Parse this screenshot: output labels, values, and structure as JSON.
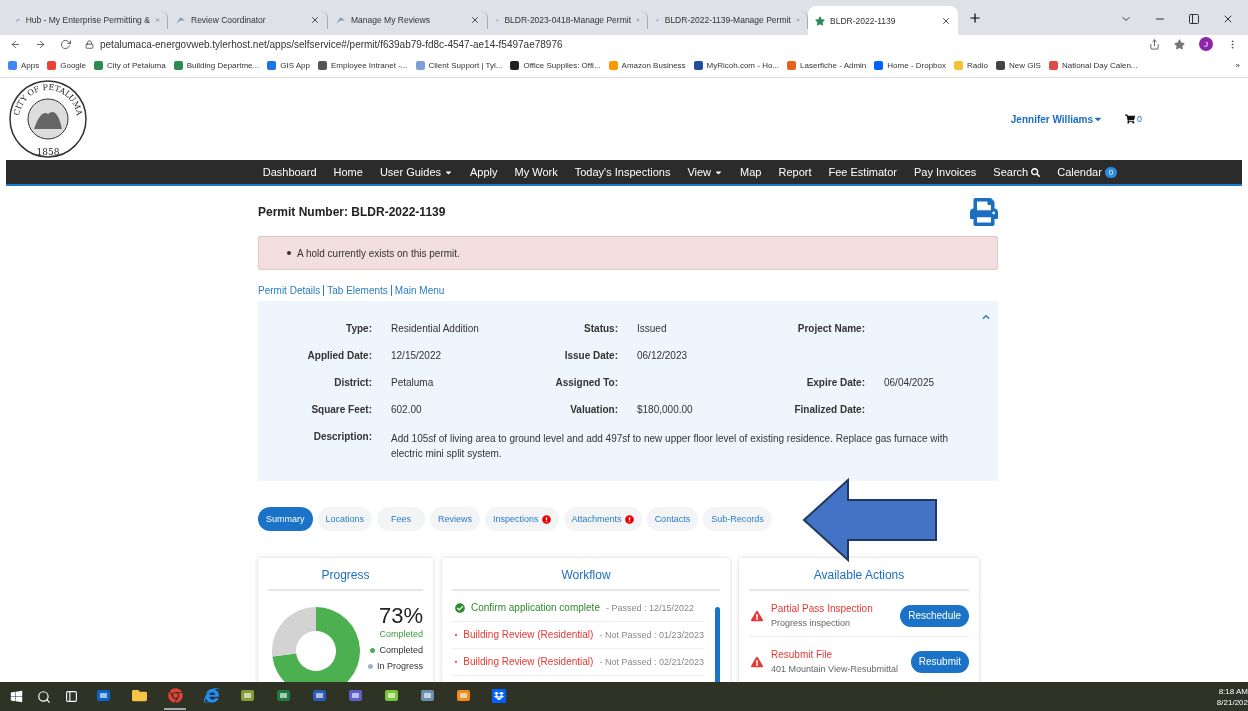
{
  "browser": {
    "tabs": [
      {
        "title": "Hub - My Enterprise Permitting &",
        "kind": "hub",
        "selected": false
      },
      {
        "title": "Review Coordinator",
        "kind": "hub",
        "selected": false
      },
      {
        "title": "Manage My Reviews",
        "kind": "hub",
        "selected": false
      },
      {
        "title": "BLDR-2023-0418-Manage Permit",
        "kind": "hub",
        "selected": false
      },
      {
        "title": "BLDR-2022-1139-Manage Permit",
        "kind": "hub",
        "selected": false
      },
      {
        "title": "BLDR-2022-1139",
        "kind": "star",
        "selected": true
      }
    ],
    "url": "petalumaca-energovweb.tylerhost.net/apps/selfservice#/permit/f639ab79-fd8c-4547-ae14-f5497ae78976",
    "profile_initial": "J",
    "bookmarks": [
      {
        "label": "Apps",
        "color": "#4285f4"
      },
      {
        "label": "Google",
        "color": "#ea4335"
      },
      {
        "label": "City of Petaluma",
        "color": "#2e8b57"
      },
      {
        "label": "Building Departme...",
        "color": "#2e8b57"
      },
      {
        "label": "GIS App",
        "color": "#1a73e8"
      },
      {
        "label": "Employee Intranet -...",
        "color": "#555555"
      },
      {
        "label": "Client Support | Tyl...",
        "color": "#7aa0d6"
      },
      {
        "label": "Office Supplies: Offi...",
        "color": "#222222"
      },
      {
        "label": "Amazon Business",
        "color": "#ff9900"
      },
      {
        "label": "MyRicoh.com - Ho...",
        "color": "#1f4e9c"
      },
      {
        "label": "Laserfiche - Admin",
        "color": "#e8601c"
      },
      {
        "label": "Home - Dropbox",
        "color": "#0061fe"
      },
      {
        "label": "Radio",
        "color": "#f4c430"
      },
      {
        "label": "New GIS",
        "color": "#444444"
      },
      {
        "label": "National Day Calen...",
        "color": "#e04a4a"
      }
    ],
    "more": "»"
  },
  "header": {
    "seal": {
      "name": "CITY OF PETALUMA",
      "year": "1858"
    },
    "user": "Jennifer Williams",
    "cart_count": "0"
  },
  "nav": [
    {
      "label": "Dashboard",
      "kind": "link"
    },
    {
      "label": "Home",
      "kind": "link"
    },
    {
      "label": "User Guides",
      "kind": "dropdown"
    },
    {
      "label": "Apply",
      "kind": "link"
    },
    {
      "label": "My Work",
      "kind": "link"
    },
    {
      "label": "Today's Inspections",
      "kind": "link"
    },
    {
      "label": "View",
      "kind": "dropdown"
    },
    {
      "label": "Map",
      "kind": "link"
    },
    {
      "label": "Report",
      "kind": "link"
    },
    {
      "label": "Fee Estimator",
      "kind": "link"
    },
    {
      "label": "Pay Invoices",
      "kind": "link"
    },
    {
      "label": "Search",
      "kind": "search"
    },
    {
      "label": "Calendar",
      "kind": "badge",
      "badge": "0"
    }
  ],
  "permit": {
    "title": "Permit Number: BLDR-2022-1139",
    "alert": "A hold currently exists on this permit.",
    "links": [
      "Permit Details",
      "Tab Elements",
      "Main Menu"
    ],
    "details": [
      [
        {
          "label": "Type:",
          "value": "Residential Addition"
        },
        {
          "label": "Status:",
          "value": "Issued"
        },
        {
          "label": "Project Name:"
        }
      ],
      [
        {
          "label": "Applied Date:",
          "value": "12/15/2022"
        },
        {
          "label": "Issue Date:",
          "value": "06/12/2023"
        }
      ],
      [
        {
          "label": "District:",
          "value": "Petaluma"
        },
        {
          "label": "Assigned To:"
        },
        {
          "label": "Expire Date:",
          "value": "06/04/2025"
        }
      ],
      [
        {
          "label": "Square Feet:",
          "value": "602.00"
        },
        {
          "label": "Valuation:",
          "value": "$180,000.00"
        },
        {
          "label": "Finalized Date:"
        }
      ]
    ],
    "description": {
      "label": "Description:",
      "value": "Add 105sf of living area to ground level and add 497sf to new upper floor level of existing residence. Replace gas furnace with electric mini split system."
    }
  },
  "tabs": [
    {
      "label": "Summary",
      "selected": true,
      "alert": false
    },
    {
      "label": "Locations",
      "selected": false,
      "alert": false
    },
    {
      "label": "Fees",
      "selected": false,
      "alert": false
    },
    {
      "label": "Reviews",
      "selected": false,
      "alert": false
    },
    {
      "label": "Inspections",
      "selected": false,
      "alert": true
    },
    {
      "label": "Attachments",
      "selected": false,
      "alert": true
    },
    {
      "label": "Contacts",
      "selected": false,
      "alert": false
    },
    {
      "label": "Sub-Records",
      "selected": false,
      "alert": false
    }
  ],
  "progress": {
    "title": "Progress",
    "percent": "73%",
    "caption": "Completed",
    "chart_data": {
      "type": "donut",
      "categories": [
        "Completed",
        "In Progress"
      ],
      "values": [
        73,
        27
      ]
    }
  },
  "workflow": {
    "title": "Workflow",
    "steps": [
      {
        "name": "Confirm application complete",
        "result": "- Passed : 12/15/2022",
        "passed": true
      },
      {
        "name": "Building Review (Residential)",
        "result": "- Not Passed : 01/23/2023",
        "passed": false
      },
      {
        "name": "Building Review (Residential)",
        "result": "- Not Passed : 02/21/2023",
        "passed": false
      }
    ]
  },
  "actions": {
    "title": "Available Actions",
    "items": [
      {
        "name": "Partial Pass Inspection",
        "detail": "Progress inspection",
        "button": "Reschedule"
      },
      {
        "name": "Resubmit File",
        "detail": "401 Mountain View-Resubmittal",
        "button": "Resubmit"
      }
    ]
  },
  "taskbar": {
    "apps": [
      {
        "kind": "outlook",
        "active": false
      },
      {
        "kind": "folder",
        "active": false
      },
      {
        "kind": "chrome",
        "active": true
      },
      {
        "kind": "ie",
        "active": false
      },
      {
        "kind": "app",
        "active": false
      },
      {
        "kind": "excel",
        "active": false
      },
      {
        "kind": "word",
        "active": false
      },
      {
        "kind": "teams",
        "active": false
      },
      {
        "kind": "bars",
        "active": false
      },
      {
        "kind": "window",
        "active": false
      },
      {
        "kind": "r",
        "active": false
      },
      {
        "kind": "dropbox",
        "active": false
      }
    ],
    "time": "8:18 AM",
    "date": "8/21/202"
  }
}
